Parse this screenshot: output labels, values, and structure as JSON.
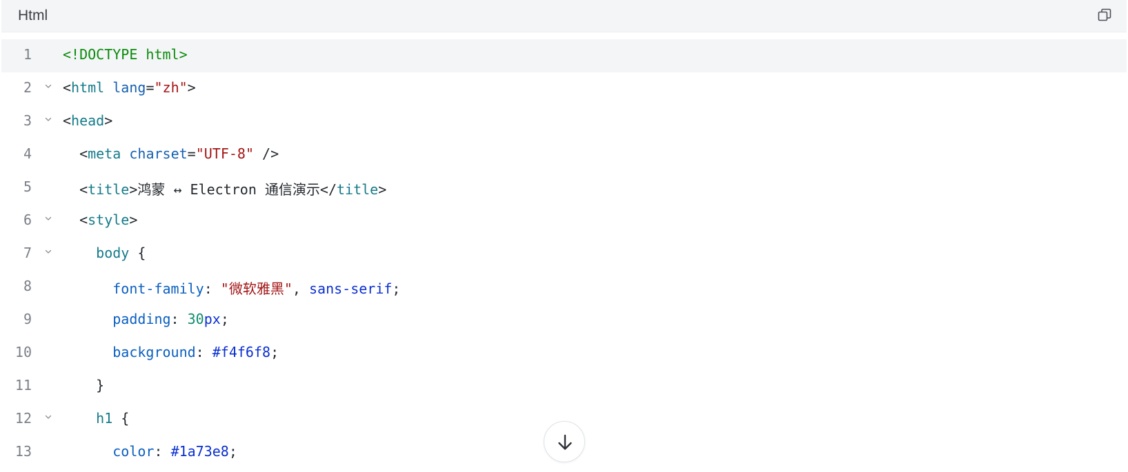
{
  "header": {
    "language_label": "Html",
    "copy_icon": "copy-icon"
  },
  "code_lines": [
    {
      "number": "1",
      "foldable": false,
      "tokens": [
        {
          "t": "doctype",
          "v": "<!DOCTYPE html>"
        }
      ]
    },
    {
      "number": "2",
      "foldable": true,
      "tokens": [
        {
          "t": "punc",
          "v": "<"
        },
        {
          "t": "tag",
          "v": "html"
        },
        {
          "t": "text",
          "v": " "
        },
        {
          "t": "attr",
          "v": "lang"
        },
        {
          "t": "punc",
          "v": "="
        },
        {
          "t": "str",
          "v": "\"zh\""
        },
        {
          "t": "punc",
          "v": ">"
        }
      ]
    },
    {
      "number": "3",
      "foldable": true,
      "tokens": [
        {
          "t": "punc",
          "v": "<"
        },
        {
          "t": "tag",
          "v": "head"
        },
        {
          "t": "punc",
          "v": ">"
        }
      ]
    },
    {
      "number": "4",
      "foldable": false,
      "tokens": [
        {
          "t": "text",
          "v": "  "
        },
        {
          "t": "punc",
          "v": "<"
        },
        {
          "t": "tag",
          "v": "meta"
        },
        {
          "t": "text",
          "v": " "
        },
        {
          "t": "attr",
          "v": "charset"
        },
        {
          "t": "punc",
          "v": "="
        },
        {
          "t": "str",
          "v": "\"UTF-8\""
        },
        {
          "t": "punc",
          "v": " />"
        }
      ]
    },
    {
      "number": "5",
      "foldable": false,
      "tokens": [
        {
          "t": "text",
          "v": "  "
        },
        {
          "t": "punc",
          "v": "<"
        },
        {
          "t": "tag",
          "v": "title"
        },
        {
          "t": "punc",
          "v": ">"
        },
        {
          "t": "text",
          "v": "鸿蒙 ↔ Electron 通信演示"
        },
        {
          "t": "punc",
          "v": "</"
        },
        {
          "t": "tag",
          "v": "title"
        },
        {
          "t": "punc",
          "v": ">"
        }
      ]
    },
    {
      "number": "6",
      "foldable": true,
      "tokens": [
        {
          "t": "text",
          "v": "  "
        },
        {
          "t": "punc",
          "v": "<"
        },
        {
          "t": "tag",
          "v": "style"
        },
        {
          "t": "punc",
          "v": ">"
        }
      ]
    },
    {
      "number": "7",
      "foldable": true,
      "tokens": [
        {
          "t": "text",
          "v": "    "
        },
        {
          "t": "tag",
          "v": "body"
        },
        {
          "t": "punc",
          "v": " {"
        }
      ]
    },
    {
      "number": "8",
      "foldable": false,
      "tokens": [
        {
          "t": "text",
          "v": "      "
        },
        {
          "t": "prop",
          "v": "font-family"
        },
        {
          "t": "punc",
          "v": ": "
        },
        {
          "t": "str",
          "v": "\"微软雅黑\""
        },
        {
          "t": "punc",
          "v": ", "
        },
        {
          "t": "kw",
          "v": "sans-serif"
        },
        {
          "t": "punc",
          "v": ";"
        }
      ]
    },
    {
      "number": "9",
      "foldable": false,
      "tokens": [
        {
          "t": "text",
          "v": "      "
        },
        {
          "t": "prop",
          "v": "padding"
        },
        {
          "t": "punc",
          "v": ": "
        },
        {
          "t": "num",
          "v": "30"
        },
        {
          "t": "kw",
          "v": "px"
        },
        {
          "t": "punc",
          "v": ";"
        }
      ]
    },
    {
      "number": "10",
      "foldable": false,
      "tokens": [
        {
          "t": "text",
          "v": "      "
        },
        {
          "t": "prop",
          "v": "background"
        },
        {
          "t": "punc",
          "v": ": "
        },
        {
          "t": "kw",
          "v": "#f4f6f8"
        },
        {
          "t": "punc",
          "v": ";"
        }
      ]
    },
    {
      "number": "11",
      "foldable": false,
      "tokens": [
        {
          "t": "text",
          "v": "    "
        },
        {
          "t": "punc",
          "v": "}"
        }
      ]
    },
    {
      "number": "12",
      "foldable": true,
      "tokens": [
        {
          "t": "text",
          "v": "    "
        },
        {
          "t": "tag",
          "v": "h1"
        },
        {
          "t": "punc",
          "v": " {"
        }
      ]
    },
    {
      "number": "13",
      "foldable": false,
      "tokens": [
        {
          "t": "text",
          "v": "      "
        },
        {
          "t": "prop",
          "v": "color"
        },
        {
          "t": "punc",
          "v": ": "
        },
        {
          "t": "kw",
          "v": "#1a73e8"
        },
        {
          "t": "punc",
          "v": ";"
        }
      ]
    }
  ],
  "active_line": "1",
  "scroll_button": {
    "icon": "arrow-down-icon"
  },
  "colors": {
    "header_bg": "#f4f5f7",
    "active_line_bg": "#f4f5f7",
    "doctype": "#0a8a0a",
    "tag": "#157a8a",
    "attribute": "#1660b0",
    "string": "#a31515",
    "property": "#0a5fc0",
    "number": "#0c8d6a",
    "keyword": "#0a2fd0"
  }
}
